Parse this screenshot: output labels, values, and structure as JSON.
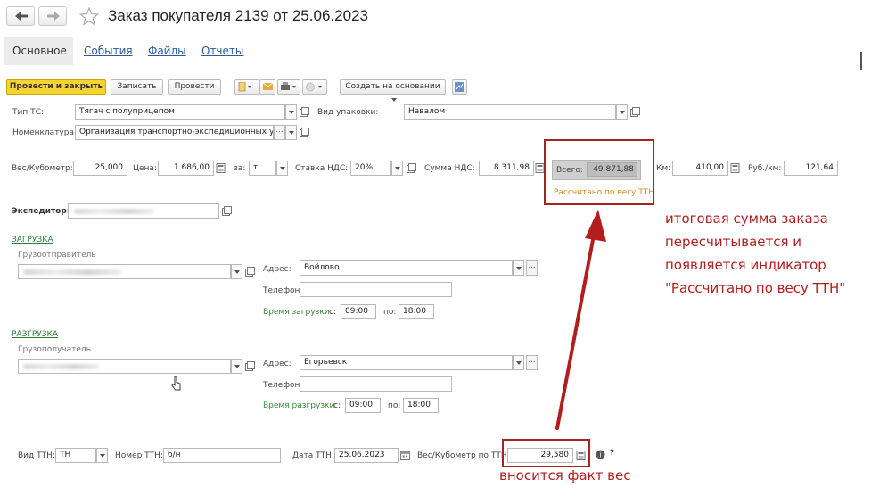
{
  "window": {
    "title": "Заказ покупателя 2139 от 25.06.2023"
  },
  "tabs": [
    {
      "label": "Основное",
      "active": true
    },
    {
      "label": "События"
    },
    {
      "label": "Файлы"
    },
    {
      "label": "Отчеты"
    }
  ],
  "toolbar": {
    "post_close": "Провести и закрыть",
    "save": "Записать",
    "post": "Провести",
    "create_based": "Создать на основании"
  },
  "form": {
    "vehicle_type": {
      "label": "Тип ТС:",
      "value": "Тягач с полуприцепом"
    },
    "package_type": {
      "label": "Вид упаковки:",
      "value": "Навалом"
    },
    "nomenclature": {
      "label": "Номенклатура:",
      "value": "Организация транспортно-экспедиционных услуг"
    },
    "weight": {
      "label": "Вес/Кубометр:",
      "value": "25,000"
    },
    "price": {
      "label": "Цена:",
      "value": "1 686,00"
    },
    "per": {
      "label": "за:",
      "value": "т"
    },
    "vat_rate": {
      "label": "Ставка НДС:",
      "value": "20%"
    },
    "vat_sum": {
      "label": "Сумма НДС:",
      "value": "8 311,98"
    },
    "total": {
      "label": "Всего:",
      "value": "49 871,88"
    },
    "km": {
      "label": "Км:",
      "value": "410,00"
    },
    "rub_km": {
      "label": "Руб./км:",
      "value": "121,64"
    },
    "calc_indicator": "Рассчитано по весу ТТН",
    "forwarder": {
      "label": "Экспедитор:"
    }
  },
  "loading": {
    "title": "ЗАГРУЗКА",
    "shipper_label": "Грузоотправитель",
    "address_label": "Адрес:",
    "address": "Войлово",
    "phone_label": "Телефон:",
    "time_label": "Время загрузки:",
    "from_label": "с:",
    "from": "09:00",
    "to_label": "по:",
    "to": "18:00"
  },
  "unloading": {
    "title": "РАЗГРУЗКА",
    "consignee_label": "Грузополучатель",
    "address_label": "Адрес:",
    "address": "Егорьевск",
    "phone_label": "Телефон:",
    "time_label": "Время разгрузки:",
    "from_label": "с:",
    "from": "09:00",
    "to_label": "по:",
    "to": "18:00"
  },
  "ttn": {
    "type_label": "Вид ТТН:",
    "type": "ТН",
    "number_label": "Номер ТТН:",
    "number": "б/н",
    "date_label": "Дата ТТН:",
    "date": "25.06.2023",
    "weight_label": "Вес/Кубометр по ТТН:",
    "weight": "29,580",
    "help": "?"
  },
  "annotations": {
    "line1": "итоговая сумма заказа",
    "line2": "пересчитывается и",
    "line3": "появляется индикатор",
    "line4": "\"Рассчитано по весу ТТН\"",
    "bottom": "вносится факт вес"
  },
  "colors": {
    "accent_yellow": "#f5d431",
    "annotation_red": "#b21e1e",
    "link_blue": "#2a5a9a",
    "section_green": "#2a7d3b"
  }
}
